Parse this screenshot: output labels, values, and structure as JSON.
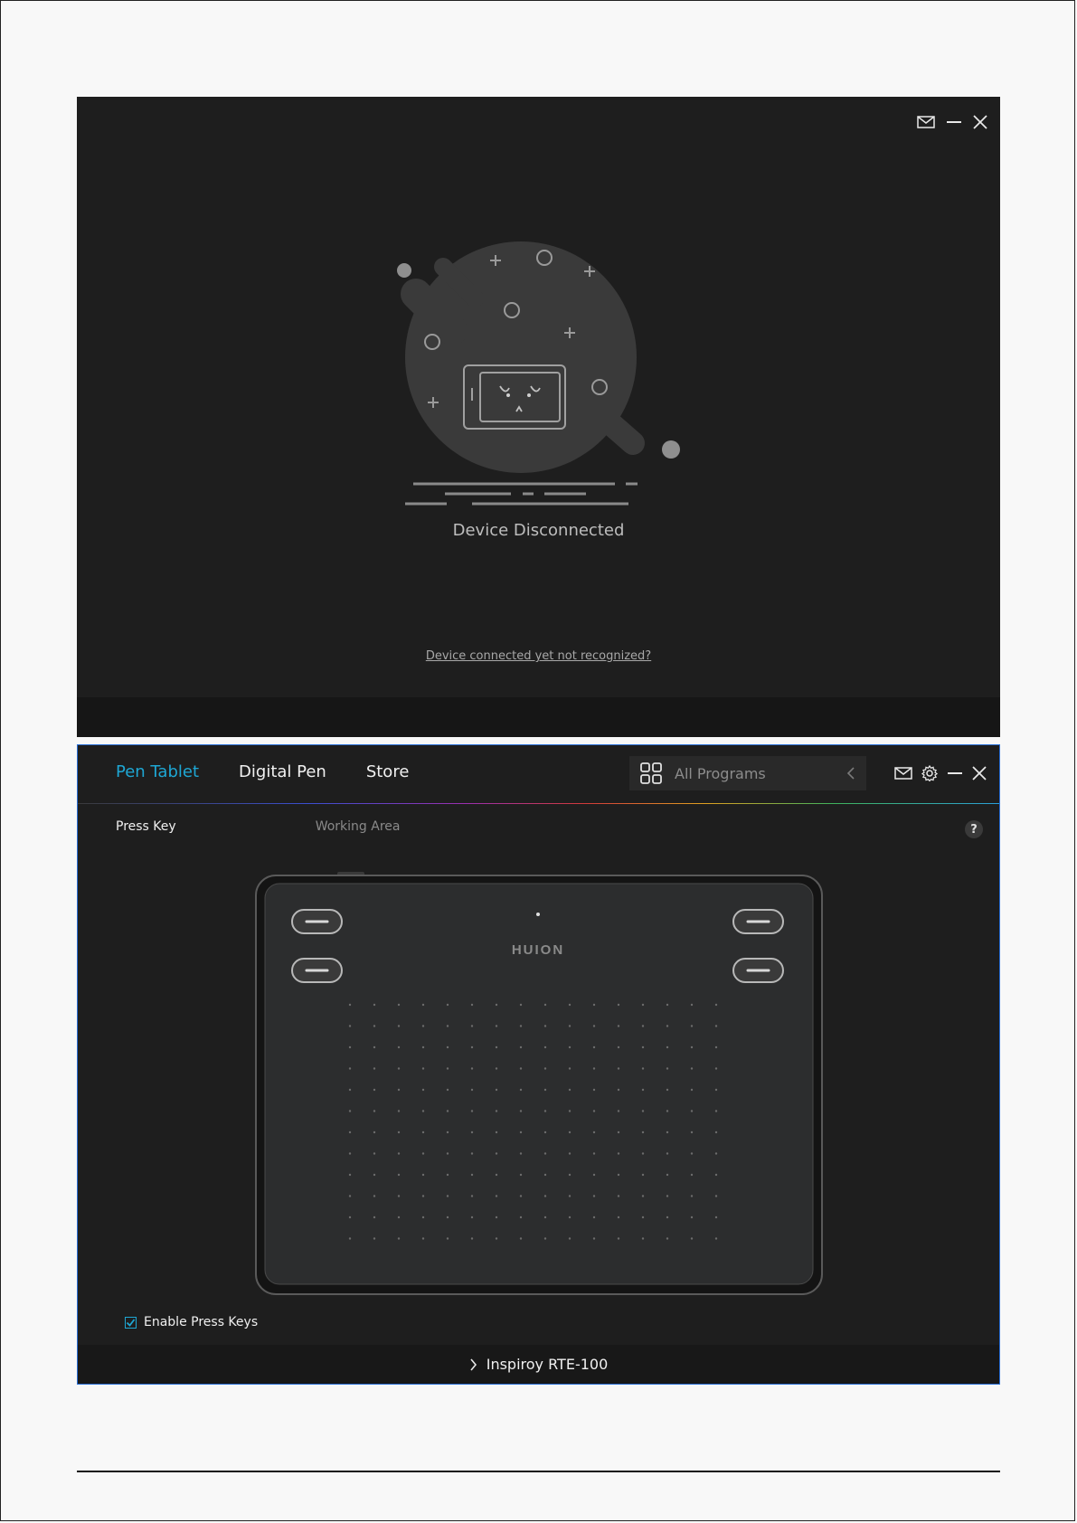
{
  "disconnected_window": {
    "status_text": "Device Disconnected",
    "help_link": "Device connected yet not recognized?",
    "controls": [
      "mail-icon",
      "minimize-icon",
      "close-icon"
    ]
  },
  "driver_window": {
    "tabs": [
      {
        "label": "Pen Tablet",
        "active": true
      },
      {
        "label": "Digital Pen",
        "active": false
      },
      {
        "label": "Store",
        "active": false
      }
    ],
    "search": {
      "placeholder": "All Programs"
    },
    "controls": [
      "mail-icon",
      "gear-icon",
      "minimize-icon",
      "close-icon"
    ],
    "subtabs": [
      {
        "label": "Press Key",
        "active": true
      },
      {
        "label": "Working Area",
        "active": false
      }
    ],
    "help_label": "?",
    "tablet": {
      "brand": "HUION"
    },
    "enable_press_keys": {
      "label": "Enable Press Keys",
      "checked": true
    },
    "device_name": "Inspiroy RTE-100"
  },
  "colors": {
    "accent": "#1ea7d4",
    "window_bg": "#1e1e1e",
    "page_bg": "#f8f8f8"
  }
}
